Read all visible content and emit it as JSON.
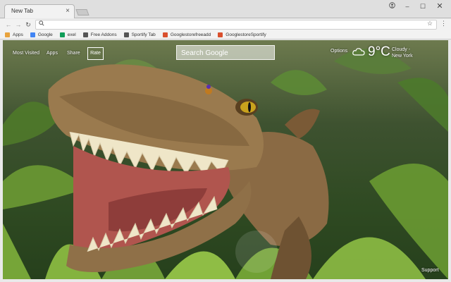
{
  "browser": {
    "tab_title": "New Tab",
    "tab_close": "×",
    "omnibox_icon": "search-icon",
    "window_controls": {
      "minimize": "–",
      "maximize": "☐",
      "close": "✕"
    }
  },
  "bookmarks": [
    {
      "label": "Apps",
      "icon": "apps-grid-icon",
      "color": "#e8a33d"
    },
    {
      "label": "Google",
      "icon": "google-icon",
      "color": "#4285f4"
    },
    {
      "label": "exel",
      "icon": "sheets-icon",
      "color": "#0f9d58"
    },
    {
      "label": "Free Addons",
      "icon": "page-icon",
      "color": "#555555"
    },
    {
      "label": "Sportify Tab",
      "icon": "page-icon",
      "color": "#555555"
    },
    {
      "label": "Googlestorefreeadd",
      "icon": "store-icon",
      "color": "#d9502e"
    },
    {
      "label": "GooglestoreSportify",
      "icon": "store-icon",
      "color": "#d9502e"
    }
  ],
  "ntp": {
    "links": {
      "most_visited": "Most Visited",
      "apps": "Apps",
      "share": "Share",
      "rate": "Rate"
    },
    "search_placeholder": "Search Google",
    "options": "Options",
    "weather": {
      "icon": "cloud-icon",
      "temp": "9°C",
      "condition": "Cloudy -",
      "city": "New York"
    },
    "support": "Support"
  }
}
